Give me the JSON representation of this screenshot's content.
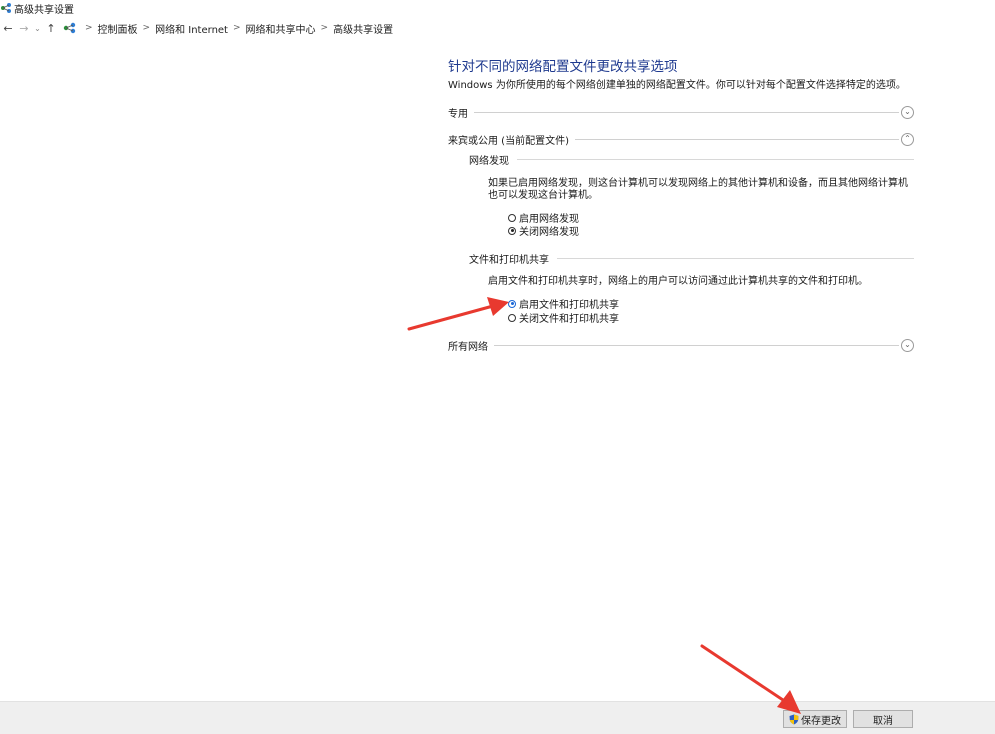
{
  "window": {
    "title": "高级共享设置"
  },
  "nav": {
    "back": "←",
    "forward": "→",
    "recent": "⌄",
    "up": "↑",
    "breadcrumb": [
      "控制面板",
      "网络和 Internet",
      "网络和共享中心",
      "高级共享设置"
    ]
  },
  "main": {
    "title": "针对不同的网络配置文件更改共享选项",
    "description": "Windows 为你所使用的每个网络创建单独的网络配置文件。你可以针对每个配置文件选择特定的选项。",
    "sections": {
      "private": {
        "label": "专用",
        "expanded": false
      },
      "guest_public": {
        "label": "来宾或公用 (当前配置文件)",
        "expanded": true,
        "network_discovery": {
          "label": "网络发现",
          "description": "如果已启用网络发现，则这台计算机可以发现网络上的其他计算机和设备，而且其他网络计算机也可以发现这台计算机。",
          "options": [
            "启用网络发现",
            "关闭网络发现"
          ],
          "selected": 1
        },
        "file_printer_sharing": {
          "label": "文件和打印机共享",
          "description": "启用文件和打印机共享时，网络上的用户可以访问通过此计算机共享的文件和打印机。",
          "options": [
            "启用文件和打印机共享",
            "关闭文件和打印机共享"
          ],
          "selected": 0
        }
      },
      "all_networks": {
        "label": "所有网络",
        "expanded": false
      }
    }
  },
  "footer": {
    "save_label": "保存更改",
    "cancel_label": "取消"
  },
  "icons": {
    "network": "network-icon",
    "shield": "uac-shield-icon",
    "chevron": "chevron-icon"
  },
  "colors": {
    "title": "#1f3a8f",
    "annotation_arrow": "#e8392f",
    "footer_bg": "#efefef"
  }
}
